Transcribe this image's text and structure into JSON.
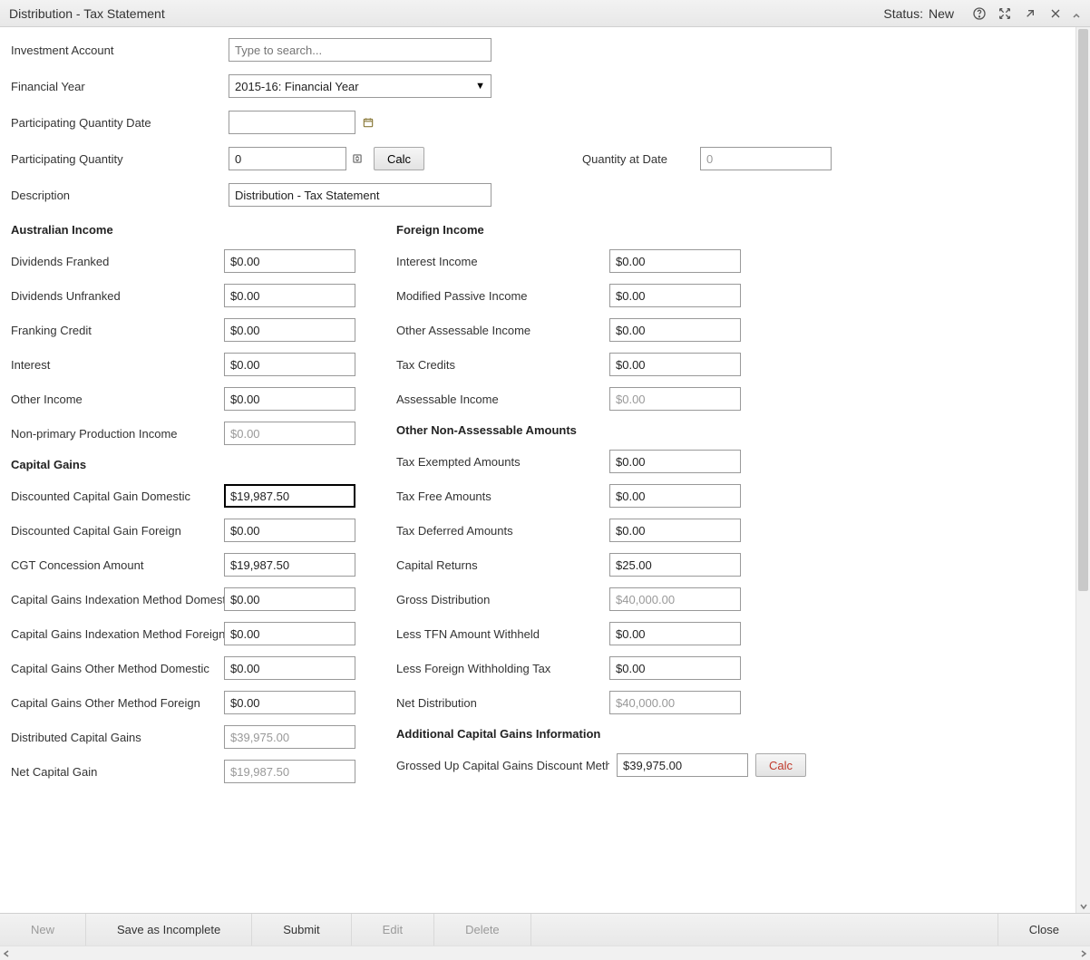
{
  "titlebar": {
    "title": "Distribution - Tax Statement",
    "status_label": "Status:",
    "status_value": "New"
  },
  "top": {
    "investment_account_label": "Investment Account",
    "investment_account_placeholder": "Type to search...",
    "investment_account_value": "",
    "financial_year_label": "Financial Year",
    "financial_year_value": "2015-16: Financial Year",
    "participating_qty_date_label": "Participating Quantity Date",
    "participating_qty_date_value": "",
    "participating_qty_label": "Participating Quantity",
    "participating_qty_value": "0",
    "calc_label": "Calc",
    "qty_at_date_label": "Quantity at Date",
    "qty_at_date_value": "0",
    "description_label": "Description",
    "description_value": "Distribution - Tax Statement"
  },
  "aus": {
    "header": "Australian Income",
    "dividends_franked_label": "Dividends Franked",
    "dividends_franked_value": "$0.00",
    "dividends_unfranked_label": "Dividends Unfranked",
    "dividends_unfranked_value": "$0.00",
    "franking_credit_label": "Franking Credit",
    "franking_credit_value": "$0.00",
    "interest_label": "Interest",
    "interest_value": "$0.00",
    "other_income_label": "Other Income",
    "other_income_value": "$0.00",
    "non_primary_label": "Non-primary Production Income",
    "non_primary_value": "$0.00"
  },
  "cg": {
    "header": "Capital Gains",
    "disc_dom_label": "Discounted Capital Gain Domestic",
    "disc_dom_value": "$19,987.50",
    "disc_for_label": "Discounted Capital Gain Foreign",
    "disc_for_value": "$0.00",
    "cgt_conc_label": "CGT Concession Amount",
    "cgt_conc_value": "$19,987.50",
    "idx_dom_label": "Capital Gains Indexation Method Domestic",
    "idx_dom_value": "$0.00",
    "idx_for_label": "Capital Gains Indexation Method Foreign",
    "idx_for_value": "$0.00",
    "other_dom_label": "Capital Gains Other Method Domestic",
    "other_dom_value": "$0.00",
    "other_for_label": "Capital Gains Other Method Foreign",
    "other_for_value": "$0.00",
    "dist_cg_label": "Distributed Capital Gains",
    "dist_cg_value": "$39,975.00",
    "net_cg_label": "Net Capital Gain",
    "net_cg_value": "$19,987.50"
  },
  "foreign": {
    "header": "Foreign Income",
    "interest_income_label": "Interest Income",
    "interest_income_value": "$0.00",
    "mod_passive_label": "Modified Passive Income",
    "mod_passive_value": "$0.00",
    "other_assess_label": "Other Assessable Income",
    "other_assess_value": "$0.00",
    "tax_credits_label": "Tax Credits",
    "tax_credits_value": "$0.00",
    "assessable_income_label": "Assessable Income",
    "assessable_income_value": "$0.00"
  },
  "otherna": {
    "header": "Other Non-Assessable Amounts",
    "tax_exempt_label": "Tax Exempted Amounts",
    "tax_exempt_value": "$0.00",
    "tax_free_label": "Tax Free Amounts",
    "tax_free_value": "$0.00",
    "tax_deferred_label": "Tax Deferred Amounts",
    "tax_deferred_value": "$0.00",
    "capital_returns_label": "Capital Returns",
    "capital_returns_value": "$25.00",
    "gross_dist_label": "Gross Distribution",
    "gross_dist_value": "$40,000.00",
    "less_tfn_label": "Less TFN Amount Withheld",
    "less_tfn_value": "$0.00",
    "less_fwt_label": "Less Foreign Withholding Tax",
    "less_fwt_value": "$0.00",
    "net_dist_label": "Net Distribution",
    "net_dist_value": "$40,000.00"
  },
  "addcg": {
    "header": "Additional Capital Gains Information",
    "grossed_up_label": "Grossed Up Capital Gains Discount Method",
    "grossed_up_value": "$39,975.00",
    "calc_label": "Calc"
  },
  "footer": {
    "new": "New",
    "save_incomplete": "Save as Incomplete",
    "submit": "Submit",
    "edit": "Edit",
    "delete": "Delete",
    "close": "Close"
  }
}
